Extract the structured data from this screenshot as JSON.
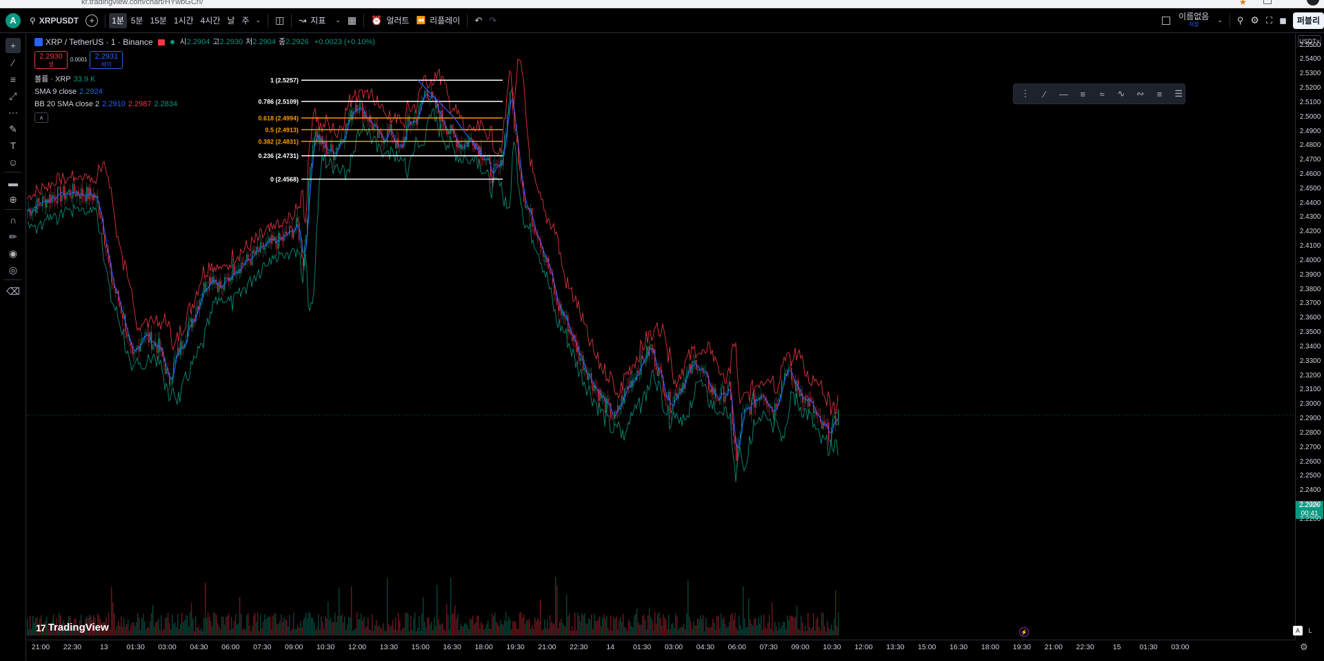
{
  "browser": {
    "url": "kr.tradingview.com/chart/HYwbGCrI/"
  },
  "topbar": {
    "avatar_letter": "A",
    "symbol": "XRPUSDT",
    "timeframes": [
      "1분",
      "5분",
      "15분",
      "1시간",
      "4시간",
      "날",
      "주"
    ],
    "active_timeframe": "1분",
    "indicators_label": "지표",
    "alert_label": "얼러트",
    "replay_label": "리플레이",
    "layout_name": "이름없음",
    "layout_sub": "저장",
    "publish_label": "퍼블리"
  },
  "legend": {
    "title": "XRP / TetherUS · 1 · Binance",
    "ohlc": [
      {
        "k": "시",
        "v": "2.2904"
      },
      {
        "k": "고",
        "v": "2.2930"
      },
      {
        "k": "저",
        "v": "2.2904"
      },
      {
        "k": "종",
        "v": "2.2926"
      }
    ],
    "change": "+0.0023 (+0.10%)",
    "sell_price": "2.2930",
    "sell_label": "셀",
    "spread": "0.0001",
    "buy_price": "2.2931",
    "buy_label": "바이",
    "volume_label": "볼륨 · XRP",
    "volume_value": "33.9 K",
    "sma_label": "SMA 9 close",
    "sma_value": "2.2924",
    "bb_label": "BB 20 SMA close 2",
    "bb_basis": "2.2910",
    "bb_upper": "2.2987",
    "bb_lower": "2.2834"
  },
  "colors": {
    "up": "#089981",
    "down": "#f23645",
    "sma": "#2962ff",
    "bb_upper": "#f23645",
    "bb_lower": "#089981",
    "fib_orange": "#ff9800",
    "fib_white": "#ffffff"
  },
  "chart_data": {
    "type": "candlestick",
    "symbol": "XRP / TetherUS",
    "interval": "1",
    "price_axis": [
      "2.5500",
      "2.5400",
      "2.5300",
      "2.5200",
      "2.5100",
      "2.5000",
      "2.4900",
      "2.4800",
      "2.4700",
      "2.4600",
      "2.4500",
      "2.4400",
      "2.4300",
      "2.4200",
      "2.4100",
      "2.4000",
      "2.3900",
      "2.3800",
      "2.3700",
      "2.3600",
      "2.3500",
      "2.3400",
      "2.3300",
      "2.3200",
      "2.3100",
      "2.3000",
      "2.2900",
      "2.2800",
      "2.2700",
      "2.2600",
      "2.2500",
      "2.2400",
      "2.2300",
      "2.2200"
    ],
    "ylim": [
      2.218,
      2.5522
    ],
    "current_price": "2.2926",
    "current_countdown": "00:41",
    "time_axis": [
      "21:00",
      "22:30",
      "13",
      "01:30",
      "03:00",
      "04:30",
      "06:00",
      "07:30",
      "09:00",
      "10:30",
      "12:00",
      "13:30",
      "15:00",
      "16:30",
      "18:00",
      "19:30",
      "21:00",
      "22:30",
      "14",
      "01:30",
      "03:00",
      "04:30",
      "06:00",
      "07:30",
      "09:00",
      "10:30",
      "12:00",
      "13:30",
      "15:00",
      "16:30",
      "18:00",
      "19:30",
      "21:00",
      "22:30",
      "15",
      "01:30",
      "03:00"
    ],
    "price_path": [
      [
        0,
        2.435
      ],
      [
        36,
        2.445
      ],
      [
        70,
        2.448
      ],
      [
        98,
        2.445
      ],
      [
        108,
        2.43
      ],
      [
        120,
        2.39
      ],
      [
        140,
        2.36
      ],
      [
        152,
        2.33
      ],
      [
        160,
        2.34
      ],
      [
        168,
        2.35
      ],
      [
        178,
        2.345
      ],
      [
        190,
        2.34
      ],
      [
        198,
        2.33
      ],
      [
        205,
        2.315
      ],
      [
        214,
        2.33
      ],
      [
        226,
        2.345
      ],
      [
        240,
        2.36
      ],
      [
        254,
        2.38
      ],
      [
        268,
        2.39
      ],
      [
        282,
        2.38
      ],
      [
        300,
        2.395
      ],
      [
        320,
        2.4
      ],
      [
        345,
        2.41
      ],
      [
        370,
        2.415
      ],
      [
        392,
        2.425
      ],
      [
        400,
        2.4
      ],
      [
        404,
        2.42
      ],
      [
        410,
        2.465
      ],
      [
        416,
        2.49
      ],
      [
        428,
        2.48
      ],
      [
        444,
        2.475
      ],
      [
        460,
        2.49
      ],
      [
        476,
        2.51
      ],
      [
        494,
        2.5
      ],
      [
        510,
        2.485
      ],
      [
        528,
        2.49
      ],
      [
        540,
        2.475
      ],
      [
        552,
        2.495
      ],
      [
        566,
        2.5
      ],
      [
        578,
        2.52
      ],
      [
        594,
        2.505
      ],
      [
        612,
        2.49
      ],
      [
        630,
        2.48
      ],
      [
        646,
        2.485
      ],
      [
        660,
        2.475
      ],
      [
        674,
        2.46
      ],
      [
        686,
        2.465
      ],
      [
        696,
        2.5
      ],
      [
        700,
        2.52
      ],
      [
        710,
        2.48
      ],
      [
        722,
        2.44
      ],
      [
        740,
        2.42
      ],
      [
        756,
        2.395
      ],
      [
        768,
        2.37
      ],
      [
        780,
        2.36
      ],
      [
        800,
        2.335
      ],
      [
        820,
        2.315
      ],
      [
        838,
        2.3
      ],
      [
        852,
        2.29
      ],
      [
        868,
        2.31
      ],
      [
        886,
        2.325
      ],
      [
        904,
        2.34
      ],
      [
        918,
        2.32
      ],
      [
        932,
        2.3
      ],
      [
        950,
        2.315
      ],
      [
        970,
        2.33
      ],
      [
        986,
        2.315
      ],
      [
        1000,
        2.305
      ],
      [
        1018,
        2.31
      ],
      [
        1028,
        2.26
      ],
      [
        1036,
        2.29
      ],
      [
        1050,
        2.3
      ],
      [
        1066,
        2.31
      ],
      [
        1082,
        2.295
      ],
      [
        1100,
        2.325
      ],
      [
        1118,
        2.31
      ],
      [
        1136,
        2.3
      ],
      [
        1150,
        2.285
      ],
      [
        1164,
        2.28
      ],
      [
        1176,
        2.293
      ]
    ],
    "fib_levels": [
      {
        "label": "1 (2.5257)",
        "price": 2.5257,
        "color": "white"
      },
      {
        "label": "0.786 (2.5109)",
        "price": 2.5109,
        "color": "white"
      },
      {
        "label": "0.618 (2.4994)",
        "price": 2.4994,
        "color": "orange"
      },
      {
        "label": "0.5 (2.4913)",
        "price": 2.4913,
        "color": "orange"
      },
      {
        "label": "0.382 (2.4831)",
        "price": 2.4831,
        "color": "orange"
      },
      {
        "label": "0.236 (2.4731)",
        "price": 2.4731,
        "color": "white"
      },
      {
        "label": "0 (2.4568)",
        "price": 2.4568,
        "color": "white"
      }
    ]
  },
  "watermark": "TradingView",
  "price_scale": {
    "currency": "USDT"
  },
  "bottom": {
    "auto_label": "A",
    "log_label": "L"
  }
}
